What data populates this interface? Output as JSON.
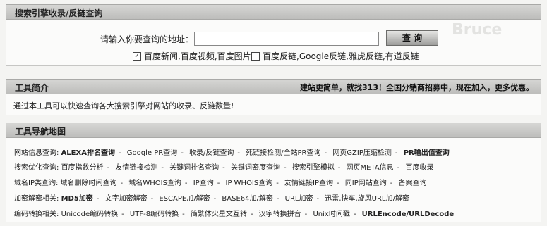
{
  "search_section": {
    "title": "搜索引擎收录/反链查询",
    "url_label": "请输入你要查询的地址：",
    "url_value": "",
    "submit_label": "查 询",
    "option1": {
      "label": "百度新闻,百度视频,百度图片",
      "checked": true
    },
    "option2": {
      "label": "百度反链,Google反链,雅虎反链,有道反链",
      "checked": false
    }
  },
  "intro_section": {
    "title": "工具简介",
    "promo": "建站更简单，就找313！全国分销商招募中，现在加入，更多优惠。",
    "text": "通过本工具可以快速查询各大搜索引擎对网站的收录、反链数量!"
  },
  "nav_section": {
    "title": "工具导航地图",
    "rows": [
      {
        "category": "网站信息查询:",
        "links": [
          "ALEXA排名查询",
          "Google PR查询",
          "收录/反链查询",
          "死链接检测/全站PR查询",
          "网页GZIP压缩检测",
          "PR输出值查询"
        ]
      },
      {
        "category": "搜索优化查询:",
        "links": [
          "百度指数分析",
          "友情链接检测",
          "关键词排名查询",
          "关键词密度查询",
          "搜索引擎模拟",
          "网页META信息",
          "百度收录"
        ]
      },
      {
        "category": "域名IP类查询:",
        "links": [
          "域名删除时间查询",
          "域名WHOIS查询",
          "IP查询",
          "IP WHOIS查询",
          "友情链接IP查询",
          "同IP网站查询",
          "备案查询"
        ]
      },
      {
        "category": "加密解密相关:",
        "links": [
          "MD5加密",
          "文字加密解密",
          "ESCAPE加/解密",
          "BASE64加/解密",
          "URL加密",
          "迅雷,快车,旋风URL加/解密"
        ]
      },
      {
        "category": "编码转换相关:",
        "links": [
          "Unicode编码转换",
          "UTF-8编码转换",
          "简繁体火星文互转",
          "汉字转换拼音",
          "Unix时间戳",
          "URLEncode/URLDecode"
        ]
      }
    ]
  },
  "watermark_text": "Bruce"
}
